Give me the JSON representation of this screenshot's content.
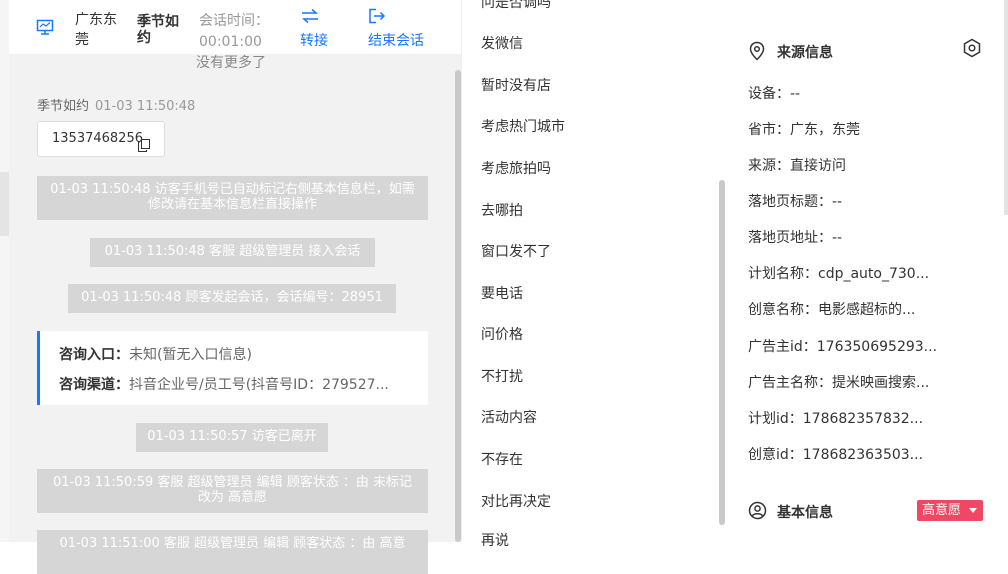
{
  "header": {
    "location": "广东东莞",
    "name": "季节如约",
    "session_label": "会话时间：",
    "session_value": "00:01:00",
    "transfer_label": "转接",
    "end_label": "结束会话"
  },
  "chat": {
    "no_more": "没有更多了",
    "sender": "季节如约",
    "sender_time": "01-03 11:50:48",
    "phone": "13537468256",
    "system_messages": [
      "01-03 11:50:48 访客手机号已自动标记右侧基本信息栏，如需修改请在基本信息栏直接操作",
      "01-03 11:50:48 客服 超级管理员 接入会话",
      "01-03 11:50:48 顾客发起会话，会话编号：28951",
      "01-03 11:50:57 访客已离开",
      "01-03 11:50:59 客服 超级管理员 编辑 顾客状态 ：由 未标记 改为 高意愿",
      "01-03 11:51:00 客服 超级管理员 编辑 顾客状态 ：由 高意"
    ],
    "consult": {
      "entry_label": "咨询入口：",
      "entry_value": "未知(暂无入口信息)",
      "channel_label": "咨询渠道：",
      "channel_value": "抖音企业号/员工号(抖音号ID：279527..."
    }
  },
  "menu": {
    "items": [
      "问是否调吗",
      "发微信",
      "暂时没有店",
      "考虑热门城市",
      "考虑旅拍吗",
      "去哪拍",
      "窗口发不了",
      "要电话",
      "问价格",
      "不打扰",
      "活动内容",
      "不存在",
      "对比再决定",
      "再说"
    ]
  },
  "source_info": {
    "title": "来源信息",
    "rows": [
      "设备：--",
      "省市：广东，东莞",
      "来源：直接访问",
      "落地页标题：--",
      "落地页地址：--",
      "计划名称：cdp_auto_730...",
      "创意名称：电影感超标的...",
      "广告主id：176350695293...",
      "广告主名称：提米映画搜索...",
      "计划id：178682357832...",
      "创意id：178682363503..."
    ]
  },
  "basic_info": {
    "title": "基本信息",
    "badge": "高意愿"
  },
  "colors": {
    "accent": "#1677ff",
    "badge": "#f04864",
    "system_msg": "#d6d6d6"
  }
}
